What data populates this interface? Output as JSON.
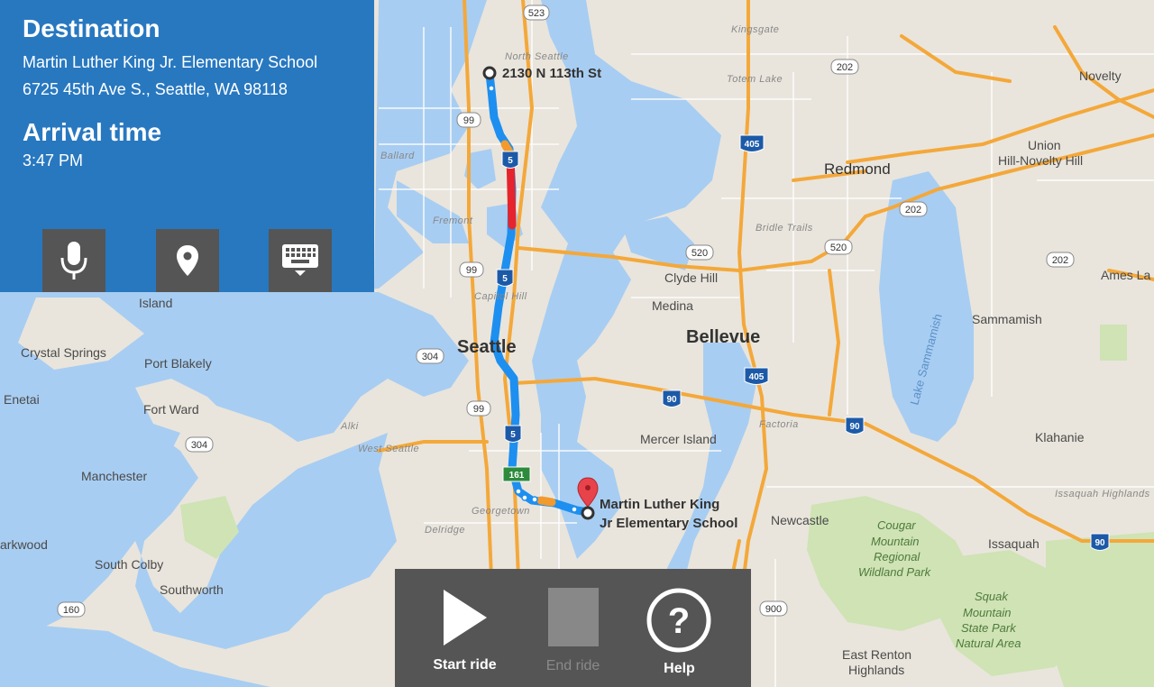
{
  "destination": {
    "heading": "Destination",
    "name": "Martin Luther King Jr. Elementary School",
    "address": "6725 45th Ave S., Seattle, WA 98118"
  },
  "arrival": {
    "heading": "Arrival time",
    "time": "3:47 PM"
  },
  "input_buttons": [
    {
      "icon": "microphone-icon"
    },
    {
      "icon": "location-pin-icon"
    },
    {
      "icon": "keyboard-icon"
    }
  ],
  "controls": {
    "start_label": "Start ride",
    "end_label": "End ride",
    "help_label": "Help",
    "end_enabled": false
  },
  "map": {
    "origin_label": "2130 N 113th St",
    "dest_label_line1": "Martin Luther King",
    "dest_label_line2": "Jr Elementary School",
    "cities": [
      "Seattle",
      "Bellevue",
      "Redmond"
    ],
    "places": [
      "North Seattle",
      "Kingsgate",
      "Totem Lake",
      "Ballard",
      "Fremont",
      "Capitol Hill",
      "Bridle Trails",
      "Alki",
      "West Seattle",
      "Georgetown",
      "Delridge",
      "Factoria",
      "Issaquah Highlands"
    ],
    "towns": [
      "Novelty",
      "Union",
      "Hill-Novelty Hill",
      "Clyde Hill",
      "Medina",
      "Ames La",
      "Sammamish",
      "Lake Sammamish",
      "Island",
      "Crystal Springs",
      "Port Blakely",
      "Enetai",
      "Fort Ward",
      "Manchester",
      "Mercer Island",
      "Klahanie",
      "Newcastle",
      "Issaquah",
      "Cougar",
      "Mountain",
      "Regional",
      "Wildland Park",
      "Squak",
      "Mountain",
      "State Park",
      "Natural Area",
      "East Renton",
      "Highlands",
      "arkwood",
      "South Colby",
      "Southworth"
    ],
    "shields": [
      "523",
      "99",
      "5",
      "99",
      "5",
      "304",
      "99",
      "5",
      "161",
      "304",
      "160",
      "202",
      "405",
      "520",
      "520",
      "202",
      "202",
      "405",
      "90",
      "90",
      "90",
      "900"
    ]
  }
}
